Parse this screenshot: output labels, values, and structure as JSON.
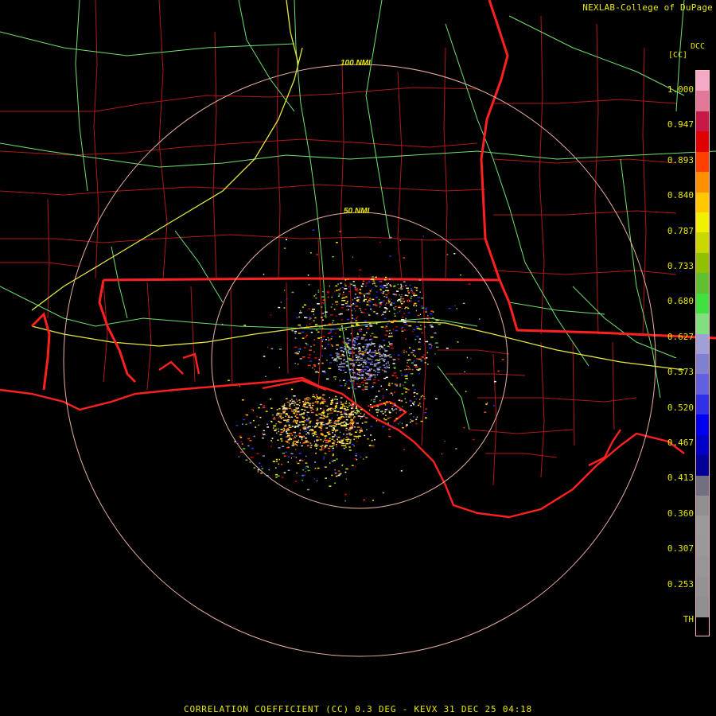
{
  "header": {
    "credit": "NEXLAB-College of DuPage",
    "product_code": "DCC",
    "units": "[CC]"
  },
  "caption": "CORRELATION COEFFICIENT (CC) 0.3 DEG - KEVX 31 DEC 25 04:18",
  "range_rings": [
    {
      "label": "50 NMI"
    },
    {
      "label": "100 NMI"
    }
  ],
  "legend": {
    "ticks": [
      "1.000",
      "0.947",
      "0.893",
      "0.840",
      "0.787",
      "0.733",
      "0.680",
      "0.627",
      "0.573",
      "0.520",
      "0.467",
      "0.413",
      "0.360",
      "0.307",
      "0.253",
      "TH"
    ],
    "colors": [
      "#f5a8c8",
      "#e07898",
      "#c81848",
      "#e00000",
      "#ff4000",
      "#ff9000",
      "#ffc800",
      "#f0f000",
      "#c8d800",
      "#90c000",
      "#60c030",
      "#40e040",
      "#80e080",
      "#a0a0d8",
      "#8080d0",
      "#6060e0",
      "#3030e8",
      "#0000f0",
      "#0000c8",
      "#000098",
      "#707080",
      "#909090",
      "#9a9a9a",
      "#999999",
      "#969696",
      "#939393",
      "#909090",
      "#000000"
    ]
  },
  "map_colors": {
    "state_border": "#ff2020",
    "county_border": "#b01818",
    "highway": "#70e070",
    "interstate": "#e8e840",
    "range_ring": "#e8b0a0"
  }
}
